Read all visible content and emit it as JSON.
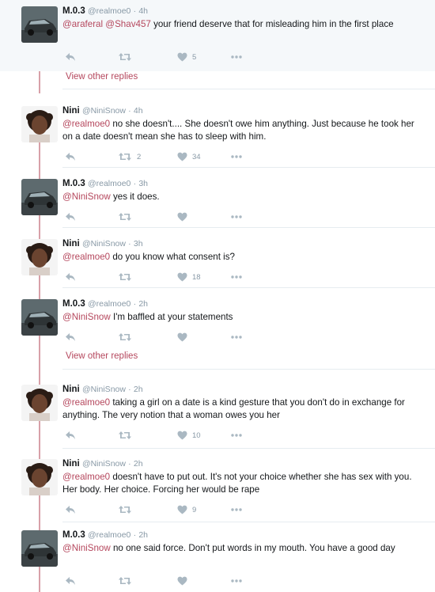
{
  "colors": {
    "accent": "#b5475d",
    "thread_line": "#d8a0a8",
    "muted": "#8899a6",
    "icon": "#aab8c2"
  },
  "icons": {
    "reply": "reply-icon",
    "retweet": "retweet-icon",
    "like": "heart-icon",
    "more": "more-icon"
  },
  "view_more_label": "View other replies",
  "tweets": [
    {
      "name": "M.0.3",
      "handle": "@realmoe0",
      "dot": "·",
      "time": "4h",
      "mention": "@araferal @Shav457",
      "text": " your friend deserve that for misleading him in the first place",
      "retweets": "",
      "likes": "5"
    },
    {
      "name": "Nini",
      "handle": "@NiniSnow",
      "dot": "·",
      "time": "4h",
      "mention": "@realmoe0",
      "text": " no she doesn't.... She doesn't owe him anything. Just because he took her on a date doesn't mean she has to sleep with him.",
      "retweets": "2",
      "likes": "34"
    },
    {
      "name": "M.0.3",
      "handle": "@realmoe0",
      "dot": "·",
      "time": "3h",
      "mention": "@NiniSnow",
      "text": " yes it does.",
      "retweets": "",
      "likes": ""
    },
    {
      "name": "Nini",
      "handle": "@NiniSnow",
      "dot": "·",
      "time": "3h",
      "mention": "@realmoe0",
      "text": " do you know what consent is?",
      "retweets": "",
      "likes": "18"
    },
    {
      "name": "M.0.3",
      "handle": "@realmoe0",
      "dot": "·",
      "time": "2h",
      "mention": "@NiniSnow",
      "text": " I'm baffled at your statements",
      "retweets": "",
      "likes": ""
    },
    {
      "name": "Nini",
      "handle": "@NiniSnow",
      "dot": "·",
      "time": "2h",
      "mention": "@realmoe0",
      "text": " taking a girl on a date is a kind gesture that you don't do in exchange for anything. The very notion that a woman owes you her",
      "retweets": "",
      "likes": "10"
    },
    {
      "name": "Nini",
      "handle": "@NiniSnow",
      "dot": "·",
      "time": "2h",
      "mention": "@realmoe0",
      "text": " doesn't have to put out. It's not your choice whether she has sex with you. Her body. Her choice. Forcing her would be rape",
      "retweets": "",
      "likes": "9"
    },
    {
      "name": "M.0.3",
      "handle": "@realmoe0",
      "dot": "·",
      "time": "2h",
      "mention": "@NiniSnow",
      "text": " no one said force. Don't put words in my mouth.  You have a good day",
      "retweets": "",
      "likes": ""
    }
  ]
}
